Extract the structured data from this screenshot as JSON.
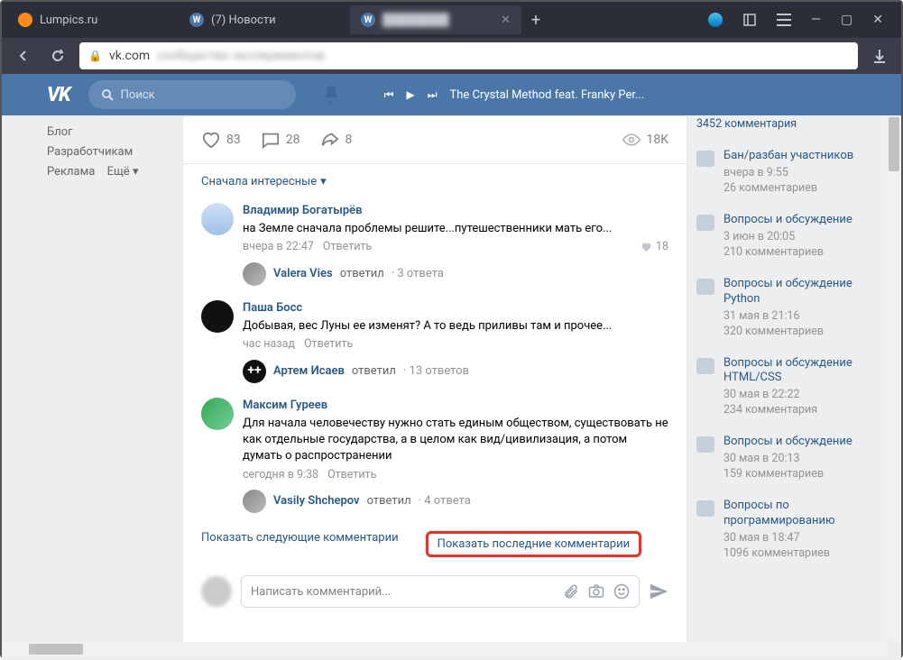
{
  "browser": {
    "tabs": [
      {
        "title": "Lumpics.ru"
      },
      {
        "title": "(7) Новости"
      },
      {
        "title": "████████"
      }
    ],
    "url_domain": "vk.com",
    "url_rest": "сообщество экспериментов"
  },
  "header": {
    "search_placeholder": "Поиск",
    "track": "The Crystal Method feat. Franky Per..."
  },
  "left_nav": {
    "blog": "Блог",
    "devs": "Разработчикам",
    "ads": "Реклама",
    "more": "Ещё"
  },
  "post": {
    "likes": "83",
    "comments": "28",
    "shares": "8",
    "views": "18K",
    "sort": "Сначала интересные"
  },
  "comments": [
    {
      "author": "Владимир Богатырёв",
      "text": "на Земле сначала проблемы решите...путешественники мать его...",
      "time": "вчера в 22:47",
      "reply_label": "Ответить",
      "likes": "18",
      "thread": {
        "who": "Valera Vies",
        "act": "ответил",
        "cnt": "3 ответа"
      }
    },
    {
      "author": "Паша Босс",
      "text": "Добывая, вес Луны ее изменят? А то ведь приливы там и прочее...",
      "time": "час назад",
      "reply_label": "Ответить",
      "thread": {
        "who": "Артем Исаев",
        "act": "ответил",
        "cnt": "13 ответов"
      }
    },
    {
      "author": "Максим Гуреев",
      "text": "Для начала человечеству нужно стать единым обществом, существовать не как отдельные государства, а в целом как вид/цивилизация, а потом думать о распространении",
      "time": "сегодня в 9:38",
      "reply_label": "Ответить",
      "thread": {
        "who": "Vasily Shchepov",
        "act": "ответил",
        "cnt": "4 ответа"
      }
    }
  ],
  "show_next": "Показать следующие комментарии",
  "show_last": "Показать последние комментарии",
  "reply_placeholder": "Написать комментарий...",
  "topics": [
    {
      "title": "",
      "meta": "",
      "cnt": "3452 комментария"
    },
    {
      "title": "Бан/разбан участников",
      "meta": "вчера в 9:55",
      "cnt": "26 комментариев"
    },
    {
      "title": "Вопросы и обсуждение",
      "meta": "3 июн в 20:05",
      "cnt": "210 комментариев"
    },
    {
      "title": "Вопросы и обсуждение\nPython",
      "meta": "31 мая в 21:16",
      "cnt": "320 комментариев"
    },
    {
      "title": "Вопросы и обсуждение\nHTML/CSS",
      "meta": "30 мая в 22:22",
      "cnt": "234 комментария"
    },
    {
      "title": "Вопросы и обсуждение",
      "meta": "30 мая в 20:13",
      "cnt": "159 комментариев"
    },
    {
      "title": "Вопросы по программированию",
      "meta": "30 мая в 18:47",
      "cnt": "1096 комментариев"
    }
  ]
}
